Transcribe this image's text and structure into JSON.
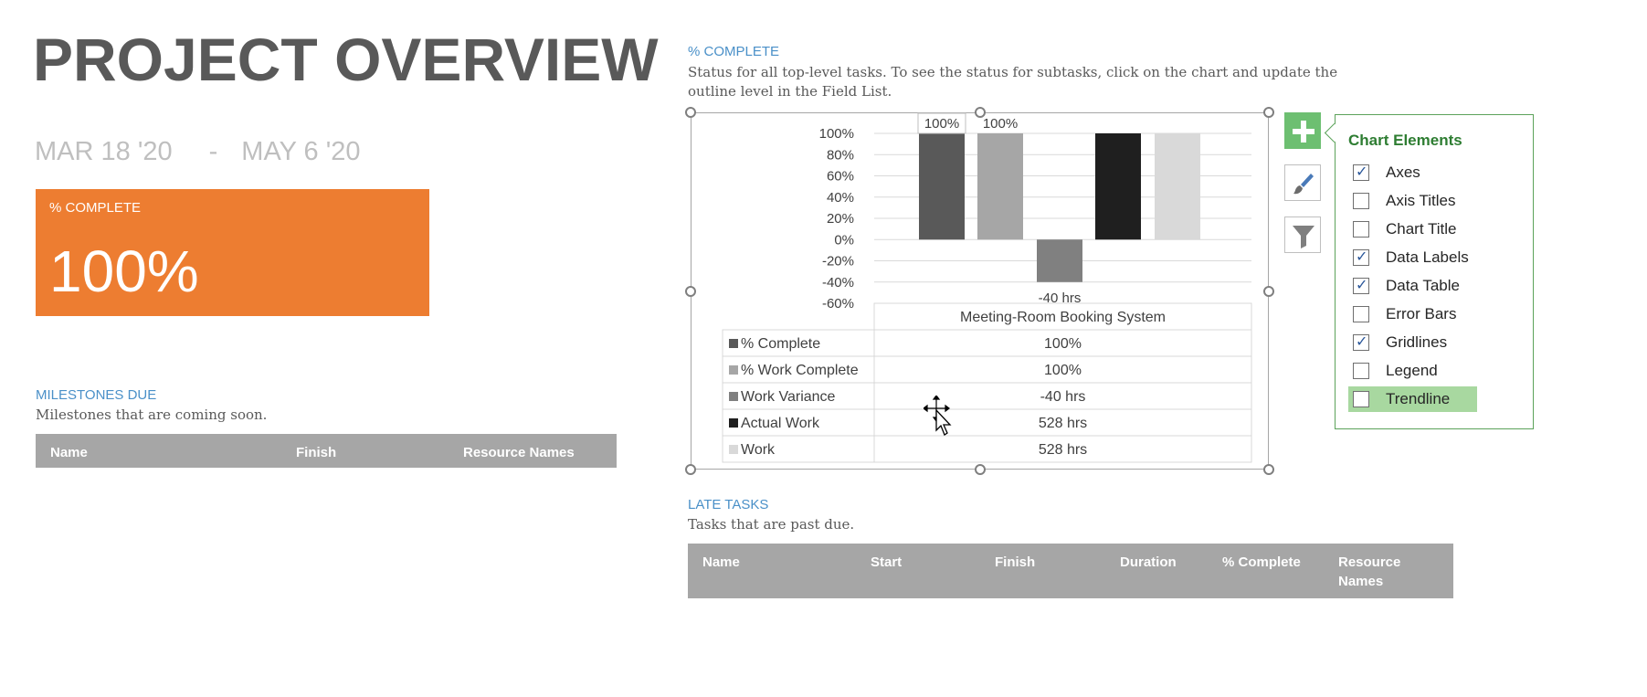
{
  "header": {
    "title": "PROJECT OVERVIEW",
    "start_date": "MAR 18 '20",
    "separator": "-",
    "end_date": "MAY 6 '20"
  },
  "kpi": {
    "label": "% COMPLETE",
    "value": "100%",
    "color": "#ed7d31"
  },
  "milestones": {
    "title": "MILESTONES DUE",
    "description": "Milestones that are coming soon.",
    "columns": [
      "Name",
      "Finish",
      "Resource Names"
    ]
  },
  "percent_complete": {
    "title": "% COMPLETE",
    "description_line1": "Status for all top-level tasks. To see the status for subtasks, click on the chart and update the",
    "description_line2": "outline level in the Field List."
  },
  "late_tasks": {
    "title": "LATE TASKS",
    "description": "Tasks that are past due.",
    "columns": [
      "Name",
      "Start",
      "Finish",
      "Duration",
      "% Complete",
      "Resource",
      "Names"
    ]
  },
  "chart_element_buttons": {
    "add": "plus-icon",
    "style": "paintbrush-icon",
    "filter": "filter-icon"
  },
  "chart_elements_panel": {
    "title": "Chart Elements",
    "items": [
      {
        "label": "Axes",
        "checked": true
      },
      {
        "label": "Axis Titles",
        "checked": false
      },
      {
        "label": "Chart Title",
        "checked": false
      },
      {
        "label": "Data Labels",
        "checked": true
      },
      {
        "label": "Data Table",
        "checked": true
      },
      {
        "label": "Error Bars",
        "checked": false
      },
      {
        "label": "Gridlines",
        "checked": true
      },
      {
        "label": "Legend",
        "checked": false
      },
      {
        "label": "Trendline",
        "checked": false,
        "highlighted": true
      }
    ],
    "check_glyph": "✓"
  },
  "chart_data": {
    "type": "bar",
    "category": "Meeting-Room Booking System",
    "ylim": [
      -0.6,
      1.0
    ],
    "y_ticks": [
      "100%",
      "80%",
      "60%",
      "40%",
      "20%",
      "0%",
      "-20%",
      "-40%",
      "-60%"
    ],
    "series": [
      {
        "name": "% Complete",
        "value": 1.0,
        "label": "100%",
        "table_value": "100%",
        "color": "#595959",
        "show_label": true,
        "label_boxed": true
      },
      {
        "name": "% Work Complete",
        "value": 1.0,
        "label": "100%",
        "table_value": "100%",
        "color": "#a6a6a6",
        "show_label": true,
        "label_boxed": false
      },
      {
        "name": "Work Variance",
        "value": -0.4,
        "label": "-40 hrs",
        "table_value": "-40 hrs",
        "color": "#808080",
        "show_label": true,
        "label_boxed": false
      },
      {
        "name": "Actual Work",
        "value": 1.0,
        "label": "528 hrs",
        "table_value": "528 hrs",
        "color": "#1f1f1f",
        "show_label": false,
        "label_boxed": false
      },
      {
        "name": "Work",
        "value": 1.0,
        "label": "528 hrs",
        "table_value": "528 hrs",
        "color": "#d9d9d9",
        "show_label": false,
        "label_boxed": false
      }
    ],
    "gridlines": true,
    "data_table": true,
    "legend": false
  }
}
